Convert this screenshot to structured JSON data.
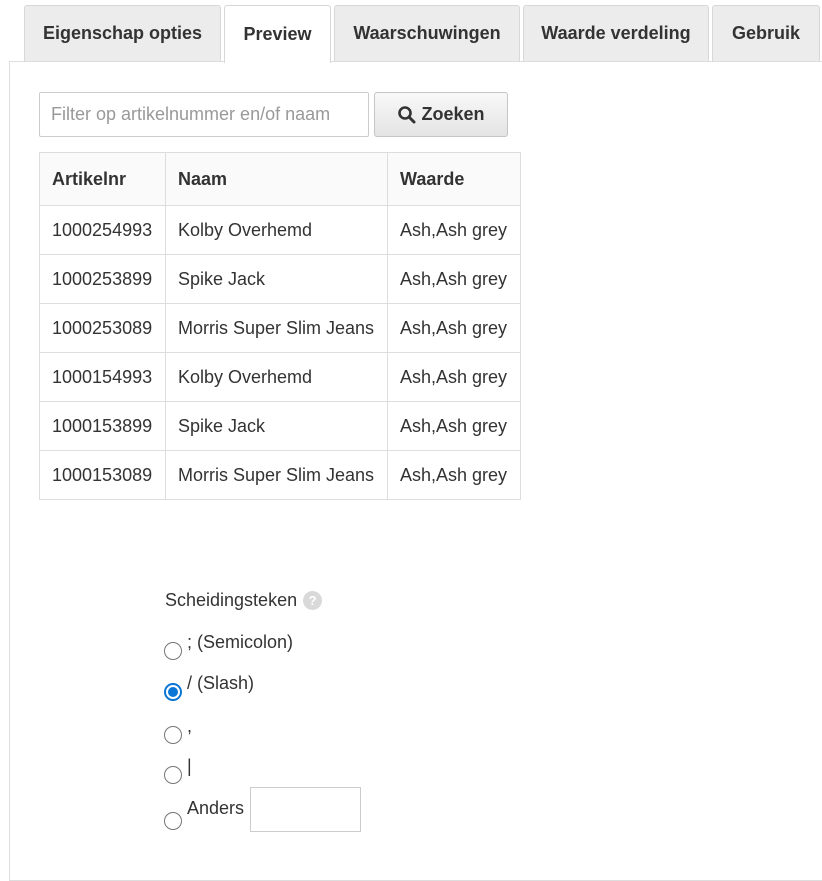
{
  "tabs": [
    {
      "label": "Eigenschap opties",
      "active": false
    },
    {
      "label": "Preview",
      "active": true
    },
    {
      "label": "Waarschuwingen",
      "active": false
    },
    {
      "label": "Waarde verdeling",
      "active": false
    },
    {
      "label": "Gebruik",
      "active": false
    }
  ],
  "search": {
    "placeholder": "Filter op artikelnummer en/of naam",
    "value": "",
    "button_label": "Zoeken",
    "button_icon": "search-icon"
  },
  "table": {
    "headers": [
      "Artikelnr",
      "Naam",
      "Waarde"
    ],
    "rows": [
      [
        "1000254993",
        "Kolby Overhemd",
        "Ash,Ash grey"
      ],
      [
        "1000253899",
        "Spike Jack",
        "Ash,Ash grey"
      ],
      [
        "1000253089",
        "Morris Super Slim Jeans",
        "Ash,Ash grey"
      ],
      [
        "1000154993",
        "Kolby Overhemd",
        "Ash,Ash grey"
      ],
      [
        "1000153899",
        "Spike Jack",
        "Ash,Ash grey"
      ],
      [
        "1000153089",
        "Morris Super Slim Jeans",
        "Ash,Ash grey"
      ]
    ]
  },
  "separator": {
    "label": "Scheidingsteken",
    "help_icon": "help-icon",
    "options": [
      {
        "label": "; (Semicolon)",
        "checked": false
      },
      {
        "label": "/ (Slash)",
        "checked": true
      },
      {
        "label": ",",
        "checked": false
      },
      {
        "label": "|",
        "checked": false
      },
      {
        "label": "Anders",
        "checked": false
      }
    ],
    "other_value": ""
  },
  "colors": {
    "accent": "#0b76d6",
    "border": "#dddddd",
    "tab_inactive": "#ececec"
  }
}
